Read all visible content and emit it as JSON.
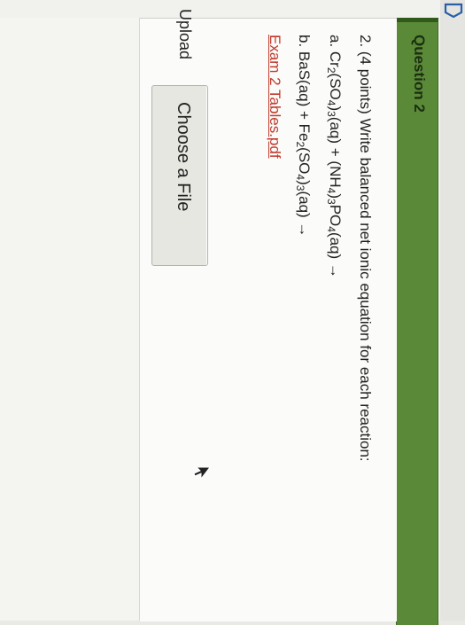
{
  "question": {
    "title": "Question 2",
    "prompt": "2. (4 points) Write balanced net ionic equation for each reaction:",
    "part_a": {
      "prefix": "a. Cr",
      "s1": "2",
      "t1": "(SO",
      "s2": "4",
      "t2": ")",
      "s3": "3",
      "t3": "(aq) + (NH",
      "s4": "4",
      "t4": ")",
      "s5": "3",
      "t5": "PO",
      "s6": "4",
      "t6": "(aq) →"
    },
    "part_b": {
      "prefix": "b. BaS(aq) + Fe",
      "s1": "2",
      "t1": "(SO",
      "s2": "4",
      "t2": ")",
      "s3": "3",
      "t3": "(aq) →"
    },
    "link_text": "Exam 2 Tables.pdf"
  },
  "upload": {
    "label": "Upload",
    "button_label": "Choose a File"
  },
  "colors": {
    "header_green": "#5a8a38",
    "link_red": "#c0392b"
  },
  "icons": [
    "back-arrow-icon",
    "mouse-cursor-icon"
  ]
}
